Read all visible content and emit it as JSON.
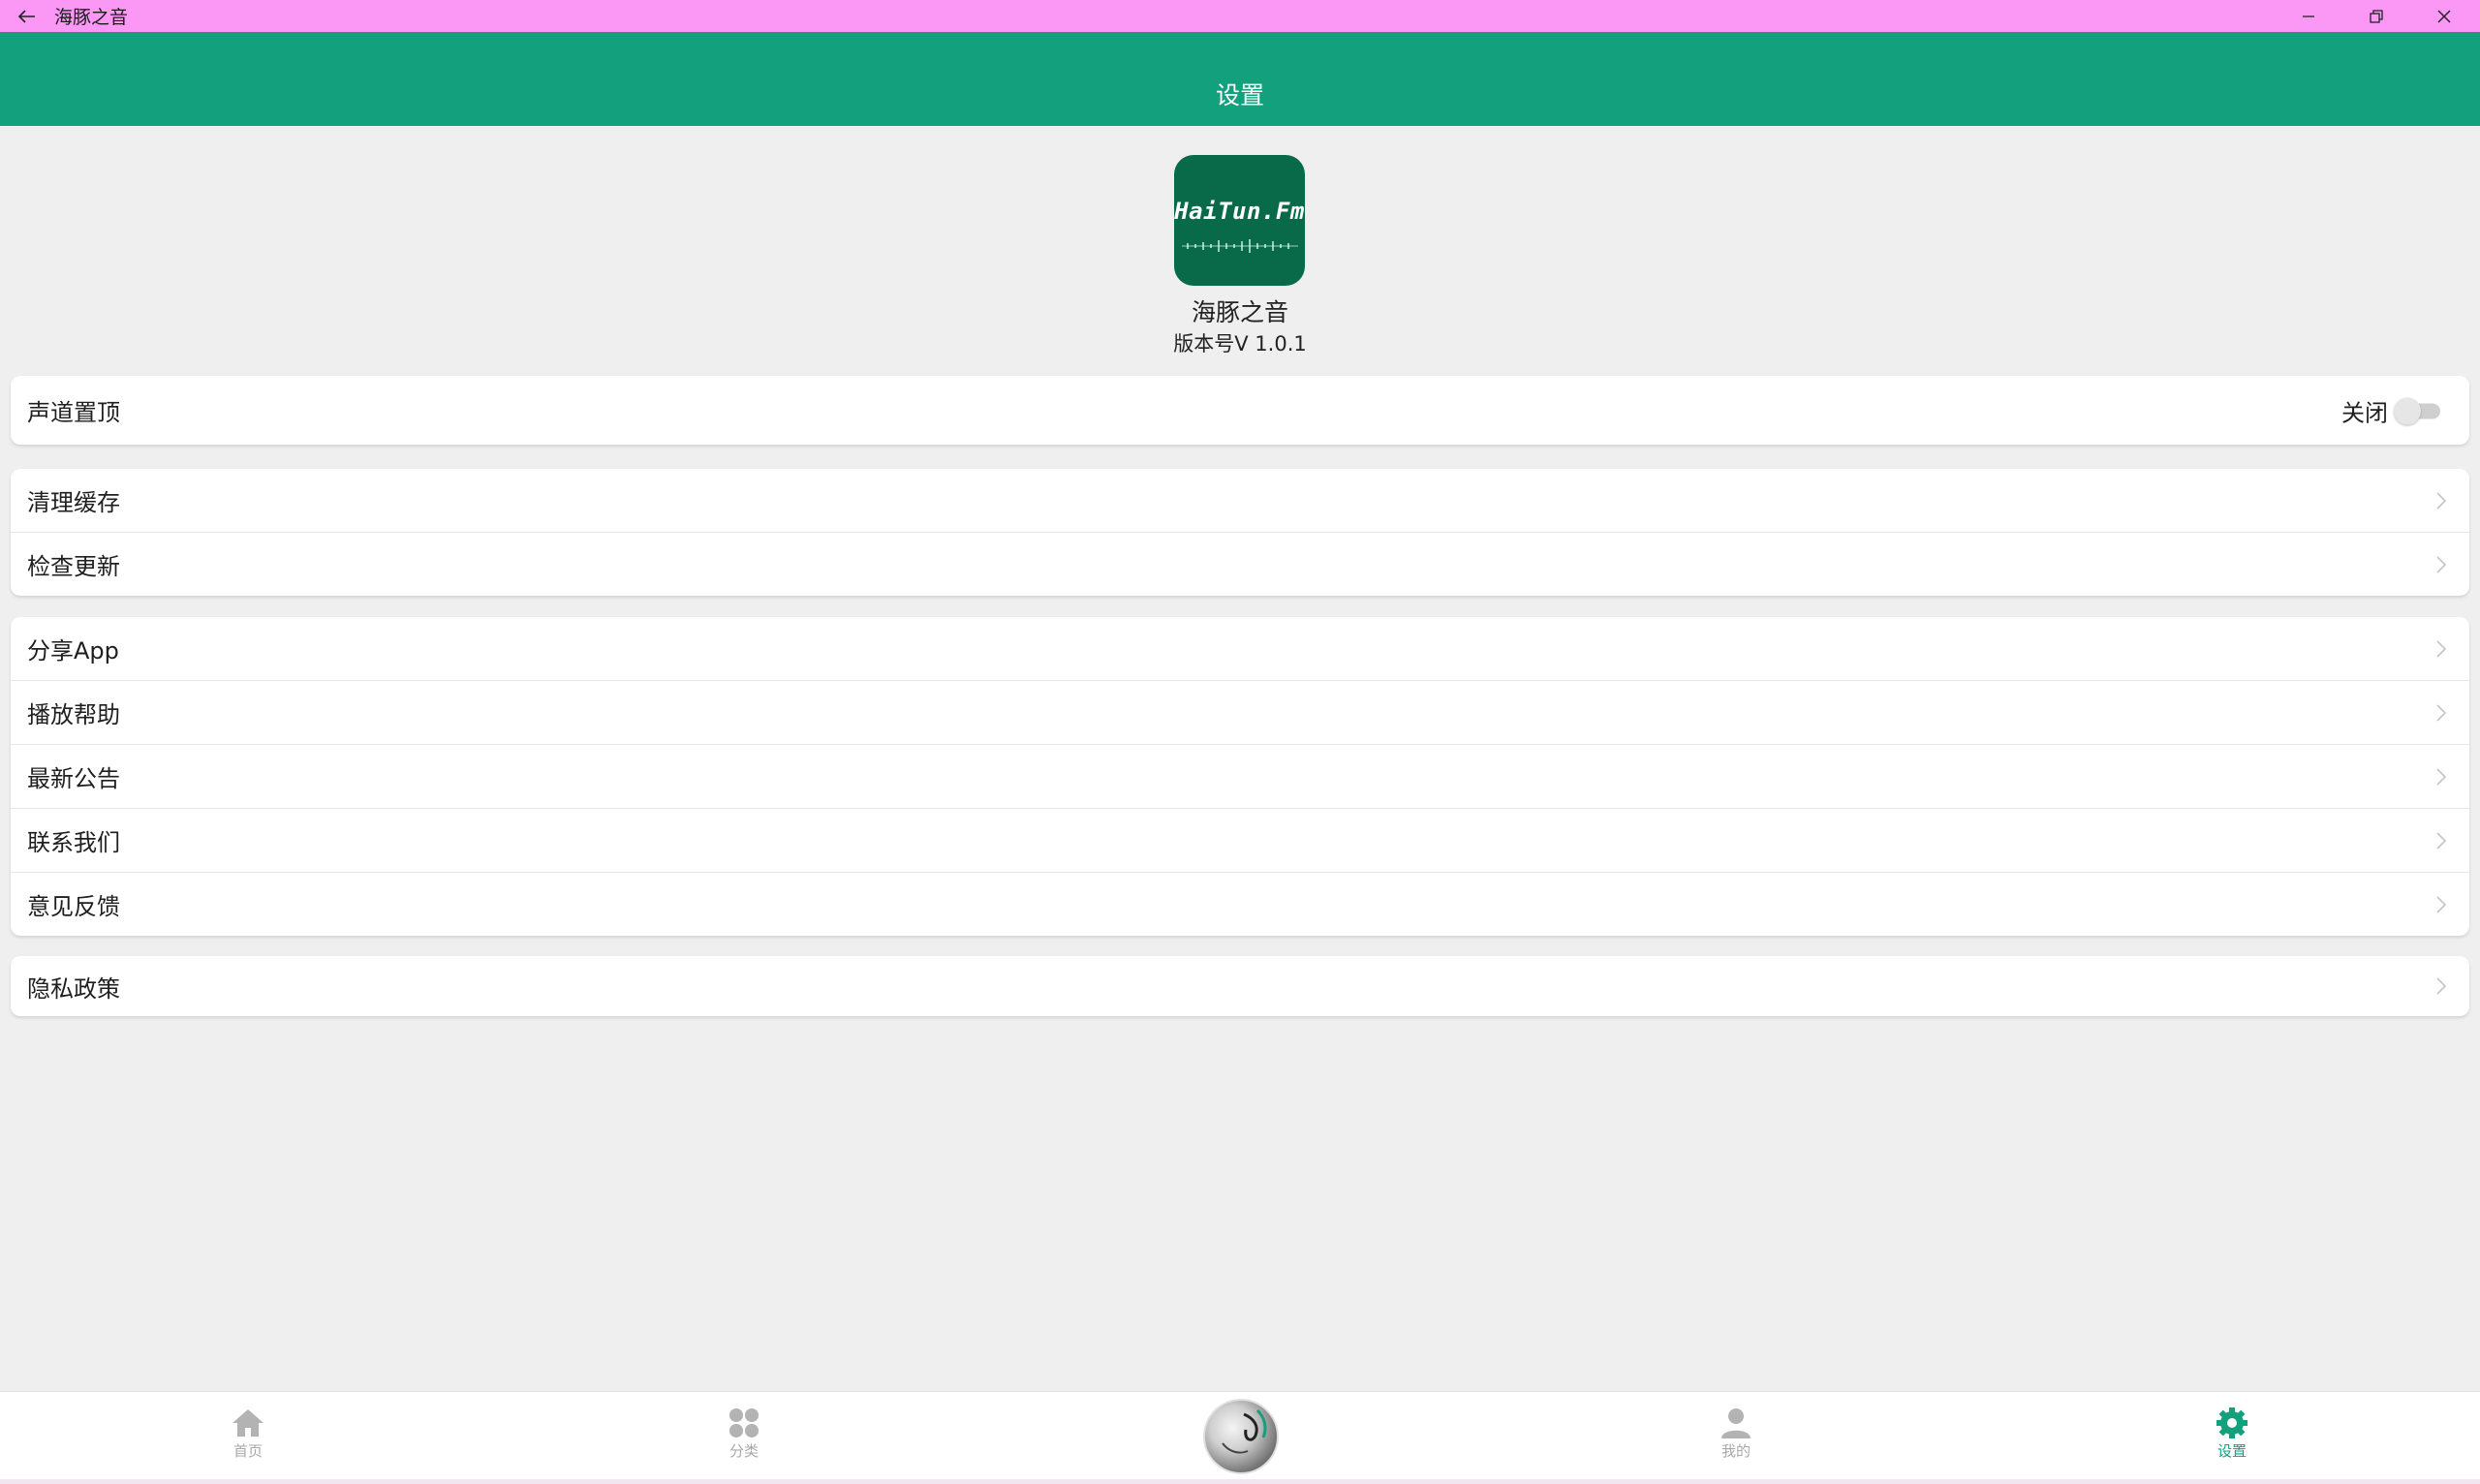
{
  "window": {
    "title": "海豚之音"
  },
  "header": {
    "title": "设置"
  },
  "app": {
    "logo_text": "HaiTun.Fm",
    "name": "海豚之音",
    "version": "版本号V 1.0.1"
  },
  "sections": {
    "channel_top": {
      "label": "声道置顶",
      "toggle_text": "关闭",
      "toggle_on": false
    },
    "clear_cache": "清理缓存",
    "check_update": "检查更新",
    "share_app": "分享App",
    "play_help": "播放帮助",
    "latest_notice": "最新公告",
    "contact_us": "联系我们",
    "feedback": "意见反馈",
    "privacy": "隐私政策"
  },
  "nav": {
    "home": "首页",
    "category": "分类",
    "mine": "我的",
    "settings": "设置",
    "active": "settings"
  },
  "colors": {
    "accent": "#13a07c",
    "titlebar": "#fb98f6",
    "logo_bg": "#096a4a",
    "background": "#efefef"
  },
  "icons": [
    "back-arrow-icon",
    "minimize-icon",
    "restore-icon",
    "close-icon",
    "chevron-right-icon",
    "home-icon",
    "category-icon",
    "user-icon",
    "gear-icon"
  ]
}
